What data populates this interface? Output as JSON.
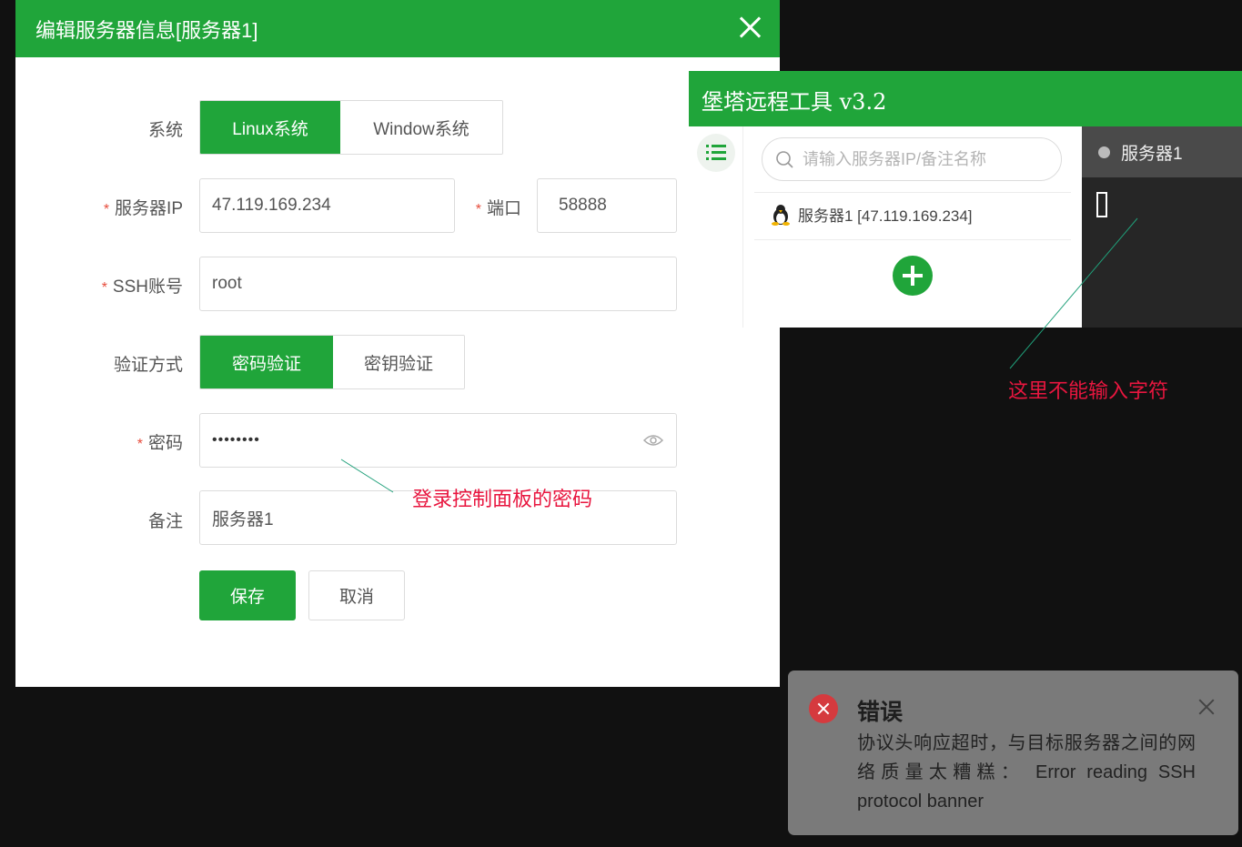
{
  "dialog": {
    "title": "编辑服务器信息[服务器1]",
    "system_label": "系统",
    "system_options": [
      "Linux系统",
      "Window系统"
    ],
    "system_selected": "Linux系统",
    "ip_label": "服务器IP",
    "ip_value": "47.119.169.234",
    "port_label": "端口",
    "port_value": "58888",
    "ssh_label": "SSH账号",
    "ssh_value": "root",
    "auth_label": "验证方式",
    "auth_options": [
      "密码验证",
      "密钥验证"
    ],
    "auth_selected": "密码验证",
    "password_label": "密码",
    "password_value": "••••••••",
    "note_label": "备注",
    "note_value": "服务器1",
    "save_label": "保存",
    "cancel_label": "取消",
    "required_mark": "*"
  },
  "annotations": {
    "password_note": "登录控制面板的密码",
    "terminal_note": "这里不能输入字符"
  },
  "tool": {
    "title": "堡塔远程工具 v3.2",
    "search_placeholder": "请输入服务器IP/备注名称",
    "server_item": "服务器1 [47.119.169.234]",
    "terminal_tab": "服务器1",
    "icons": [
      "menu-list-icon",
      "search-icon",
      "linux-penguin-icon",
      "plus-icon"
    ]
  },
  "toast": {
    "title": "错误",
    "message": "协议头响应超时，与目标服务器之间的网络质量太糟糕：  Error reading SSH protocol banner"
  },
  "colors": {
    "brand_green": "#20a53a",
    "annotation_red": "#e8163f",
    "error_red": "#d53a3e"
  }
}
